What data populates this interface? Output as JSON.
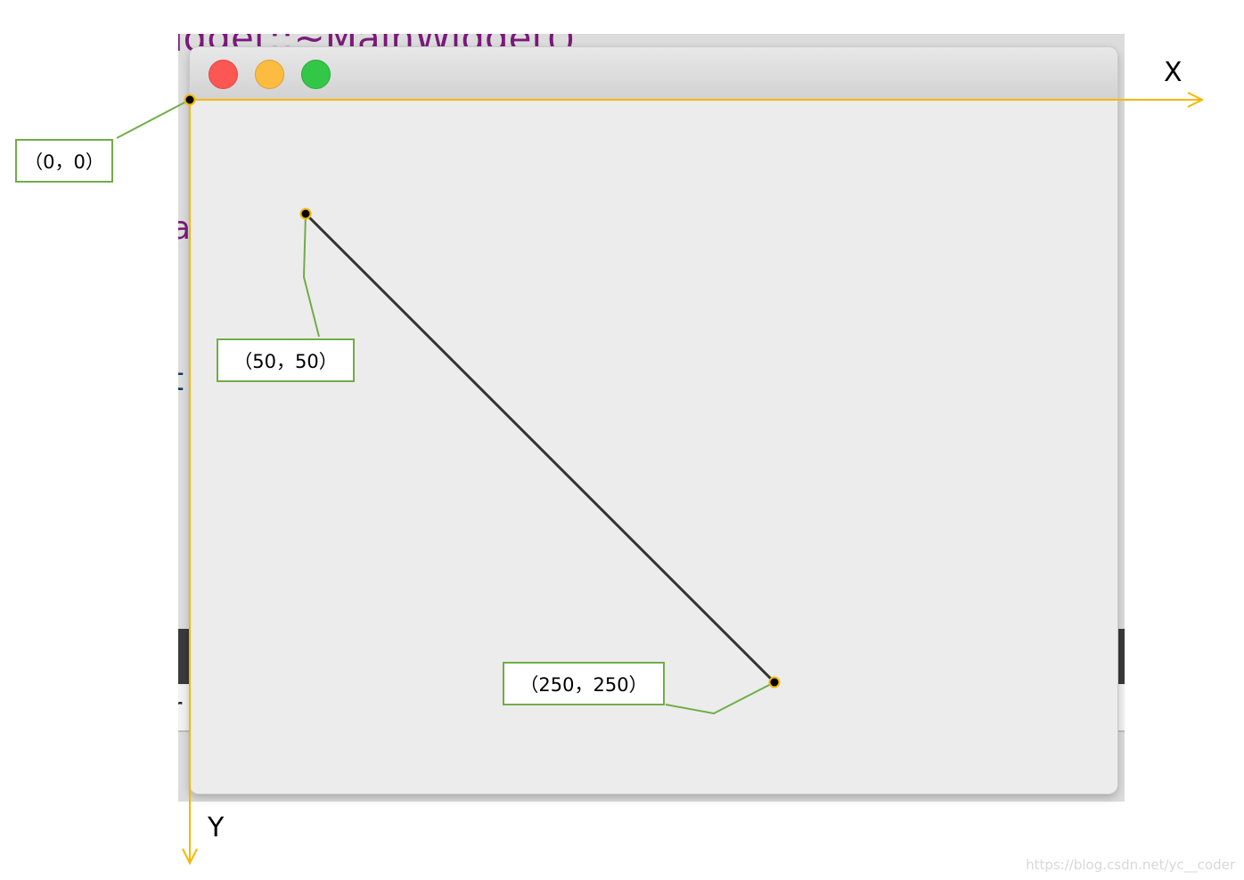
{
  "background": {
    "code_top": "idget::~MainWidget()",
    "code_fragments": [
      "a",
      "i",
      "t",
      "r"
    ]
  },
  "window": {
    "traffic_lights": {
      "close_color": "#fc5753",
      "minimize_color": "#fdbc40",
      "maximize_color": "#33c748"
    }
  },
  "annotations": {
    "origin_label": "（0，0）",
    "start_label": "（50，50）",
    "end_label": "（250，250）",
    "x_axis_label": "X",
    "y_axis_label": "Y",
    "axis_color": "#f5b800",
    "callout_color": "#70ad47",
    "line_color": "#333333"
  },
  "watermark": "https://blog.csdn.net/yc__coder"
}
